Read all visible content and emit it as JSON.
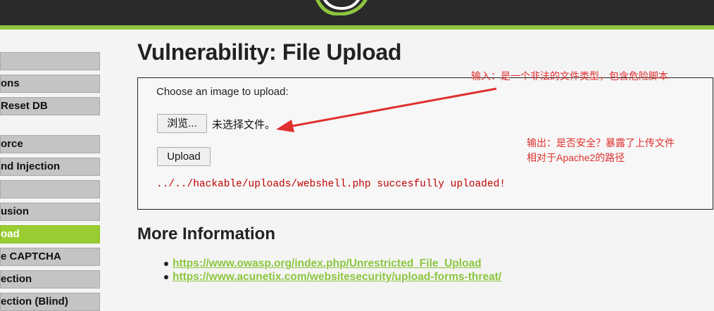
{
  "menu": {
    "items": [
      {
        "label": ""
      },
      {
        "label": "ons"
      },
      {
        "label": "Reset DB"
      },
      {
        "label": "orce"
      },
      {
        "label": "nd Injection"
      },
      {
        "label": ""
      },
      {
        "label": "usion"
      },
      {
        "label": "oad"
      },
      {
        "label": "e CAPTCHA"
      },
      {
        "label": "ection"
      },
      {
        "label": "ection (Blind)"
      }
    ],
    "active_color": "#9acd32"
  },
  "page": {
    "title": "Vulnerability: File Upload"
  },
  "upload_form": {
    "choose_label": "Choose an image to upload:",
    "browse_label": "浏览...",
    "file_status": "未选择文件。",
    "upload_label": "Upload",
    "result_message": "../../hackable/uploads/webshell.php succesfully uploaded!"
  },
  "annotations": {
    "input_note": "输入：是一个非法的文件类型，包含危险脚本",
    "output_note_line1": "输出：是否安全？暴露了上传文件",
    "output_note_line2": "相对于Apache2的路径",
    "color": "#e03030"
  },
  "more_info": {
    "title": "More Information",
    "links": [
      {
        "text": "https://www.owasp.org/index.php/Unrestricted_File_Upload"
      },
      {
        "text": "https://www.acunetix.com/websitesecurity/upload-forms-threat/"
      }
    ]
  },
  "colors": {
    "header_bg": "#2a2a2a",
    "accent_green": "#8dc63f",
    "link_green": "#8cc63f",
    "error_red": "#c00000"
  }
}
